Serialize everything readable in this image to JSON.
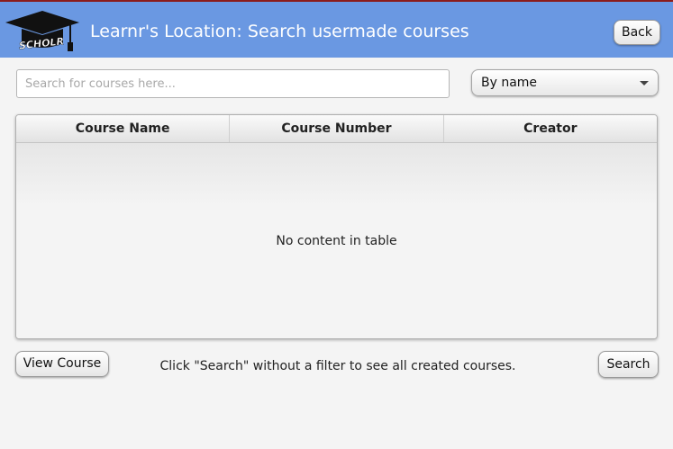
{
  "header": {
    "title": "Learnr's Location: Search usermade courses",
    "logo_text": "SCHOLR",
    "back_label": "Back",
    "background_color": "#6a98e2",
    "accent_border_color": "#8b1c1c"
  },
  "search": {
    "placeholder": "Search for courses here...",
    "value": ""
  },
  "sort": {
    "selected": "By name"
  },
  "table": {
    "columns": [
      "Course Name",
      "Course Number",
      "Creator"
    ],
    "rows": [],
    "empty_message": "No content in table"
  },
  "footer": {
    "view_course_label": "View Course",
    "hint": "Click \"Search\" without a filter to see all created courses.",
    "search_label": "Search"
  }
}
